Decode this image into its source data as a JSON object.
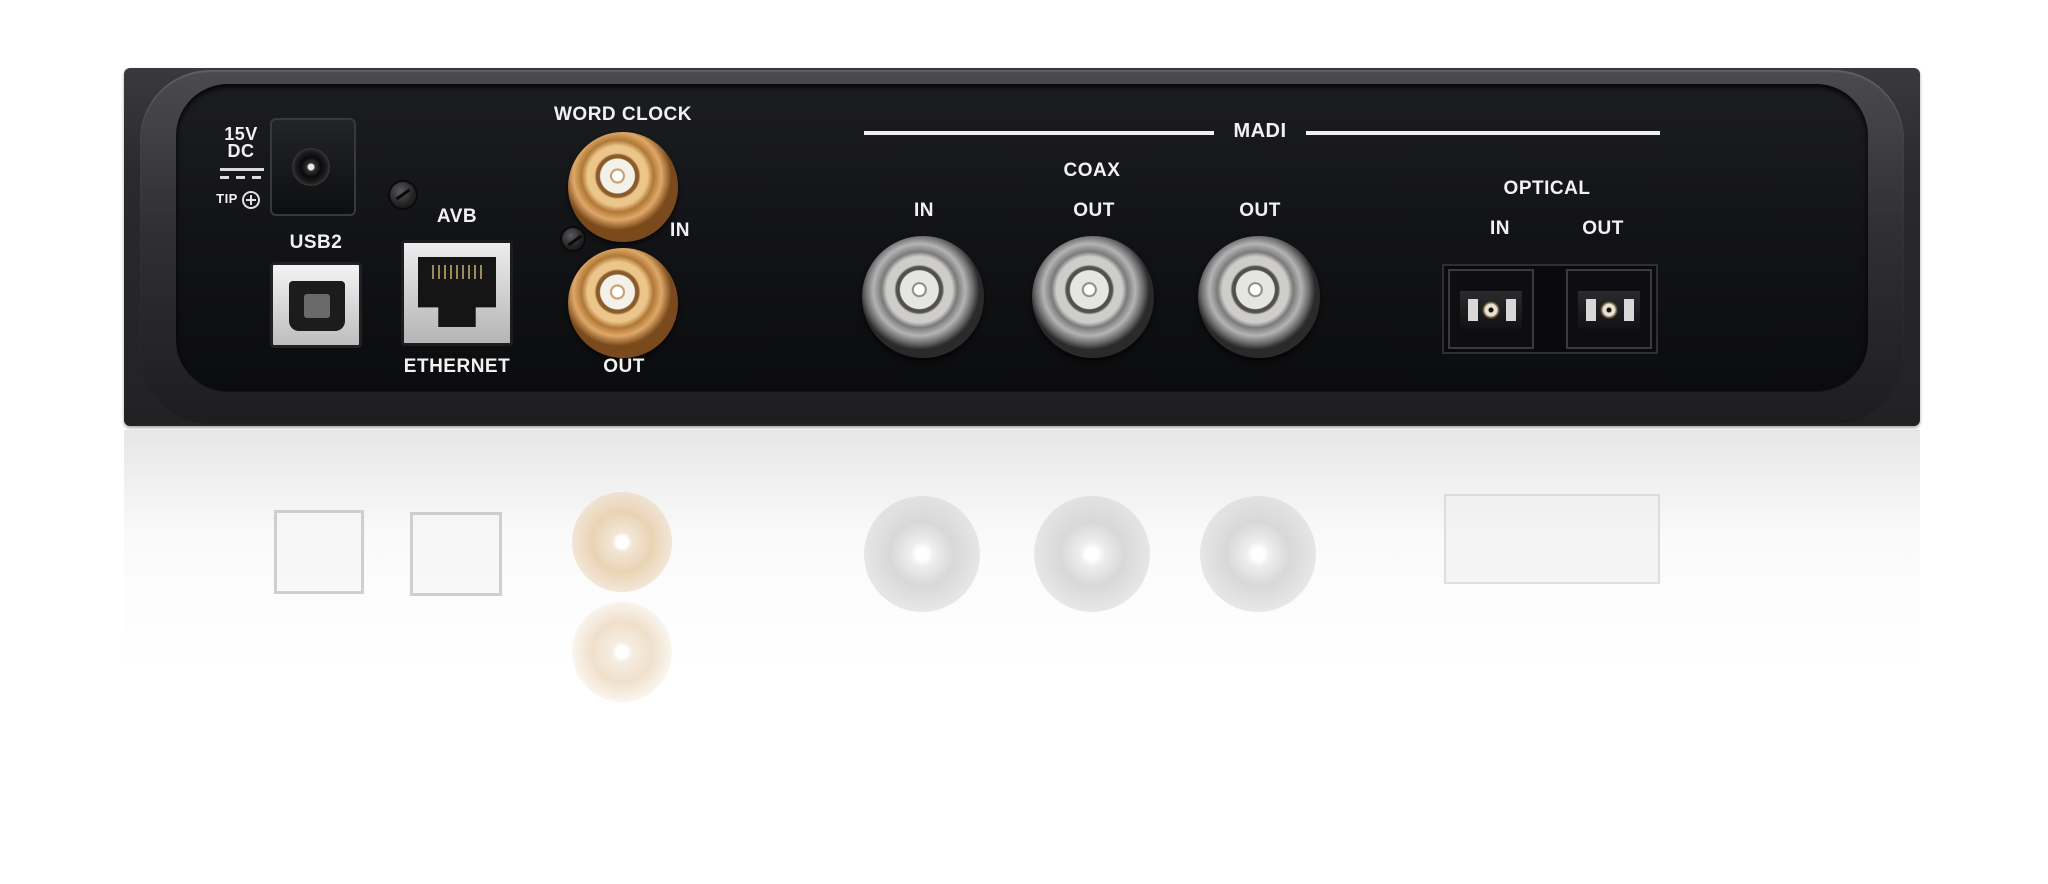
{
  "power": {
    "voltage": "15V",
    "type": "DC",
    "polarity": "TIP"
  },
  "usb": {
    "label": "USB2"
  },
  "avb": {
    "top_label": "AVB",
    "bottom_label": "ETHERNET"
  },
  "word_clock": {
    "title": "WORD CLOCK",
    "in_label": "IN",
    "out_label": "OUT"
  },
  "madi": {
    "title": "MADI",
    "coax": {
      "title": "COAX",
      "ports": [
        "IN",
        "OUT",
        "OUT"
      ]
    },
    "optical": {
      "title": "OPTICAL",
      "ports": [
        "IN",
        "OUT"
      ]
    }
  },
  "colors": {
    "panel": "#121316",
    "bezel": "#2a2a2d",
    "label": "#f2f2f2",
    "word_clock_connector": "#d9a15d",
    "coax_connector": "#b8b6b3"
  },
  "icons": [
    "dc-power-jack-icon",
    "usb-b-port-icon",
    "rj45-ethernet-port-icon",
    "bnc-connector-icon",
    "optical-connector-icon",
    "screw-icon",
    "polarity-plus-icon"
  ]
}
